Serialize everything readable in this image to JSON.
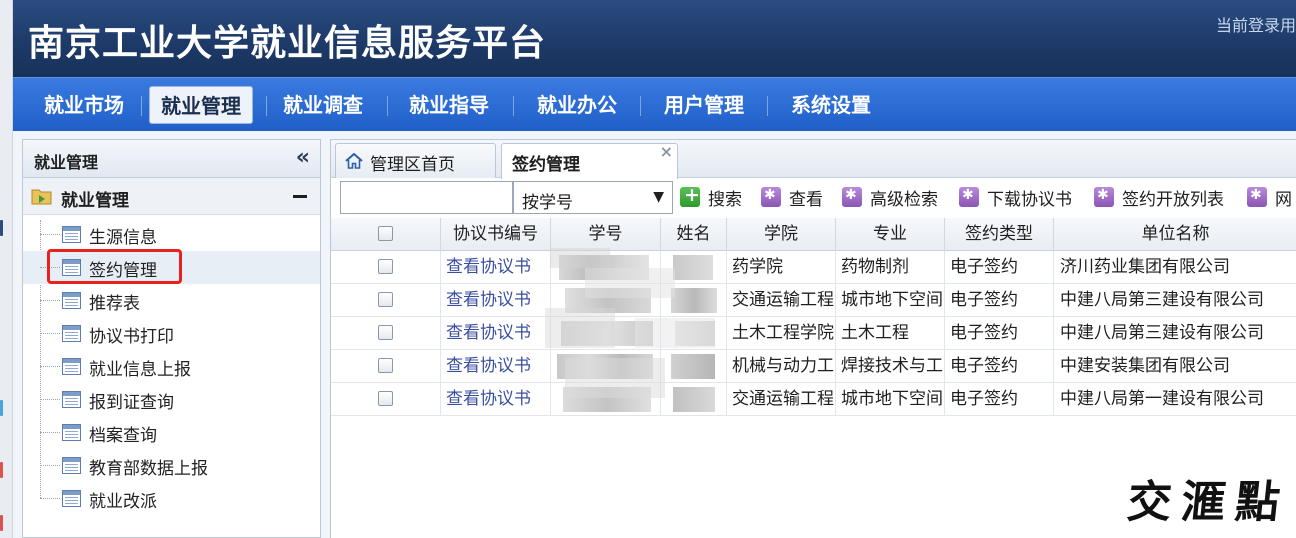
{
  "app": {
    "title": "南京工业大学就业信息服务平台",
    "login_info": "当前登录用户"
  },
  "nav": {
    "items": [
      {
        "label": "就业市场"
      },
      {
        "label": "就业管理",
        "active": true
      },
      {
        "label": "就业调查"
      },
      {
        "label": "就业指导"
      },
      {
        "label": "就业办公"
      },
      {
        "label": "用户管理"
      },
      {
        "label": "系统设置"
      }
    ]
  },
  "sidebar": {
    "title": "就业管理",
    "collapse_icon": "double-chevron-left-icon",
    "group_label": "就业管理",
    "items": [
      {
        "label": "生源信息"
      },
      {
        "label": "签约管理",
        "selected": true
      },
      {
        "label": "推荐表"
      },
      {
        "label": "协议书打印"
      },
      {
        "label": "就业信息上报"
      },
      {
        "label": "报到证查询"
      },
      {
        "label": "档案查询"
      },
      {
        "label": "教育部数据上报"
      },
      {
        "label": "就业改派"
      }
    ],
    "highlight_color": "#e8231d"
  },
  "tabs": {
    "home_label": "管理区首页",
    "active_label": "签约管理"
  },
  "toolbar": {
    "search_value": "",
    "select_value": "按学号",
    "buttons": [
      {
        "label": "搜索",
        "icon": "search-add-icon"
      },
      {
        "label": "查看",
        "icon": "view-icon"
      },
      {
        "label": "高级检索",
        "icon": "advanced-search-icon"
      },
      {
        "label": "下载协议书",
        "icon": "download-icon"
      },
      {
        "label": "签约开放列表",
        "icon": "list-icon"
      },
      {
        "label": "网",
        "icon": "web-icon"
      }
    ]
  },
  "table": {
    "columns": [
      "",
      "协议书编号",
      "学号",
      "姓名",
      "学院",
      "专业",
      "签约类型",
      "单位名称"
    ],
    "rows": [
      {
        "agreement_link": "查看协议书",
        "college": "药学院",
        "major": "药物制剂",
        "sign_type": "电子签约",
        "company": "济川药业集团有限公司"
      },
      {
        "agreement_link": "查看协议书",
        "college": "交通运输工程",
        "major": "城市地下空间",
        "sign_type": "电子签约",
        "company": "中建八局第三建设有限公司"
      },
      {
        "agreement_link": "查看协议书",
        "college": "土木工程学院",
        "major": "土木工程",
        "sign_type": "电子签约",
        "company": "中建八局第三建设有限公司"
      },
      {
        "agreement_link": "查看协议书",
        "college": "机械与动力工",
        "major": "焊接技术与工",
        "sign_type": "电子签约",
        "company": "中建安装集团有限公司"
      },
      {
        "agreement_link": "查看协议书",
        "college": "交通运输工程",
        "major": "城市地下空间",
        "sign_type": "电子签约",
        "company": "中建八局第一建设有限公司"
      }
    ]
  },
  "watermark": {
    "chars": [
      "交",
      "滙",
      "點"
    ]
  },
  "colors": {
    "header_bg": "#1d3a69",
    "nav_bg": "#2a6bd6",
    "link": "#3a4fa0",
    "highlight": "#e8231d"
  }
}
